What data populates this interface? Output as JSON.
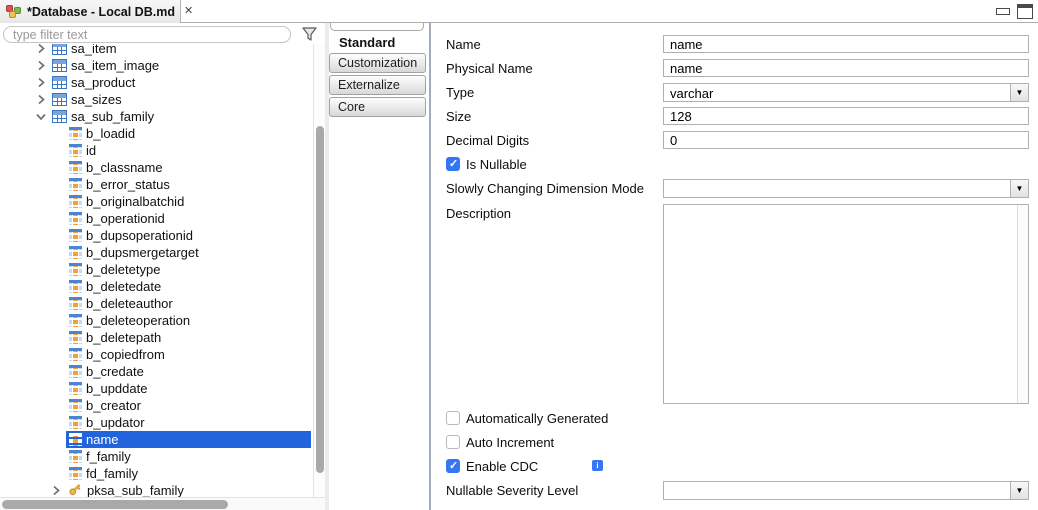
{
  "window": {
    "minimize_icon": "minimize",
    "maximize_icon": "maximize"
  },
  "editor_tab": {
    "icon": "model-file-icon",
    "title": "*Database - Local DB.md",
    "close": "✕"
  },
  "filter": {
    "placeholder": "type filter text",
    "icon": "filter-funnel-icon"
  },
  "tree": {
    "rows": [
      {
        "type": "table",
        "label": "sa_item",
        "expanded": false
      },
      {
        "type": "table",
        "label": "sa_item_image",
        "expanded": false
      },
      {
        "type": "table",
        "label": "sa_product",
        "expanded": false
      },
      {
        "type": "table",
        "label": "sa_sizes",
        "expanded": false
      },
      {
        "type": "table",
        "label": "sa_sub_family",
        "expanded": true
      },
      {
        "type": "column",
        "label": "b_loadid"
      },
      {
        "type": "column",
        "label": "id"
      },
      {
        "type": "column",
        "label": "b_classname"
      },
      {
        "type": "column",
        "label": "b_error_status"
      },
      {
        "type": "column",
        "label": "b_originalbatchid"
      },
      {
        "type": "column",
        "label": "b_operationid"
      },
      {
        "type": "column",
        "label": "b_dupsoperationid"
      },
      {
        "type": "column",
        "label": "b_dupsmergetarget"
      },
      {
        "type": "column",
        "label": "b_deletetype"
      },
      {
        "type": "column",
        "label": "b_deletedate"
      },
      {
        "type": "column",
        "label": "b_deleteauthor"
      },
      {
        "type": "column",
        "label": "b_deleteoperation"
      },
      {
        "type": "column",
        "label": "b_deletepath"
      },
      {
        "type": "column",
        "label": "b_copiedfrom"
      },
      {
        "type": "column",
        "label": "b_credate"
      },
      {
        "type": "column",
        "label": "b_upddate"
      },
      {
        "type": "column",
        "label": "b_creator"
      },
      {
        "type": "column",
        "label": "b_updator"
      },
      {
        "type": "column",
        "label": "name",
        "selected": true
      },
      {
        "type": "column",
        "label": "f_family"
      },
      {
        "type": "column",
        "label": "fd_family"
      },
      {
        "type": "key",
        "label": "pksa_sub_family",
        "expanded": false
      }
    ]
  },
  "section_tabs": {
    "items": [
      {
        "label": "Standard",
        "selected": true
      },
      {
        "label": "Customization",
        "selected": false
      },
      {
        "label": "Externalize",
        "selected": false
      },
      {
        "label": "Core",
        "selected": false
      }
    ]
  },
  "form": {
    "name": {
      "label": "Name",
      "value": "name"
    },
    "physical_name": {
      "label": "Physical Name",
      "value": "name"
    },
    "type": {
      "label": "Type",
      "value": "varchar"
    },
    "size": {
      "label": "Size",
      "value": "128"
    },
    "decimal_digits": {
      "label": "Decimal Digits",
      "value": "0"
    },
    "is_nullable": {
      "label": "Is Nullable",
      "checked": true
    },
    "scd_mode": {
      "label": "Slowly Changing Dimension Mode",
      "value": ""
    },
    "description": {
      "label": "Description",
      "value": ""
    },
    "auto_generated": {
      "label": "Automatically Generated",
      "checked": false
    },
    "auto_increment": {
      "label": "Auto Increment",
      "checked": false
    },
    "enable_cdc": {
      "label": "Enable CDC",
      "checked": true,
      "info_icon": "i"
    },
    "nullable_severity": {
      "label": "Nullable Severity Level",
      "value": ""
    }
  },
  "colors": {
    "selection_blue": "#2264dc",
    "checkbox_blue": "#3476f5",
    "table_icon_blue": "#3a77c2",
    "column_icon_orange": "#f0a136",
    "key_gold": "#f9c84a",
    "divider_blue_gray": "#a3acbf"
  }
}
